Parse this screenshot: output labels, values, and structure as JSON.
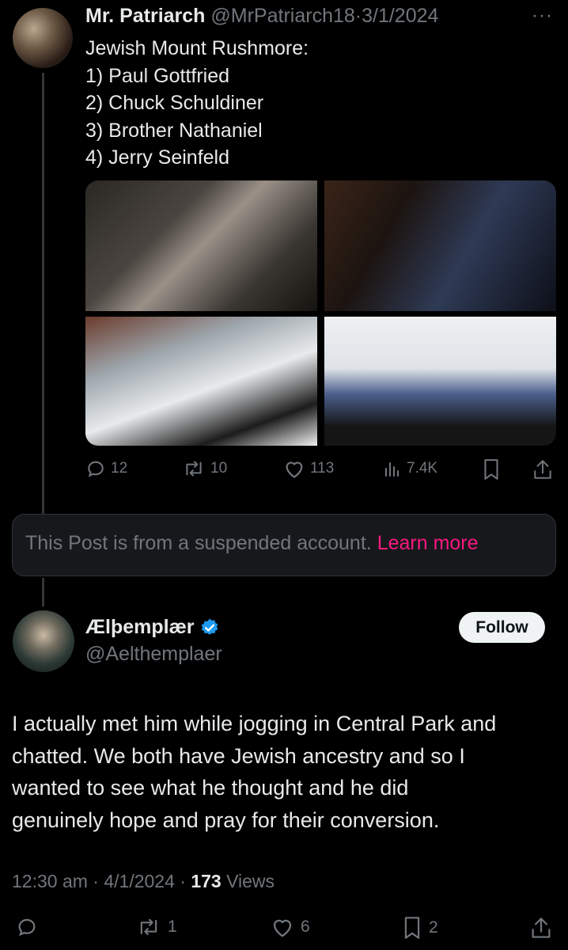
{
  "tweet1": {
    "name": "Mr. Patriarch",
    "handle": "@MrPatriarch18",
    "dot": "·",
    "date": "3/1/2024",
    "more": "···",
    "lines": [
      "Jewish Mount Rushmore:",
      "1) Paul Gottfried",
      "2) Chuck Schuldiner",
      "3) Brother Nathaniel",
      "4) Jerry Seinfeld"
    ],
    "actions": {
      "replies": "12",
      "reposts": "10",
      "likes": "113",
      "views": "7.4K"
    }
  },
  "suspended": {
    "text": "This Post is from a suspended account.",
    "link": "Learn more"
  },
  "tweet2": {
    "name": "Ælþemplær",
    "handle": "@Aelthemplaer",
    "follow_label": "Follow",
    "body_lines": [
      "I actually met him while jogging in Central Park and",
      "chatted. We both have Jewish ancestry and so I",
      "wanted to see what he thought and he did",
      "genuinely hope and pray for their conversion."
    ],
    "time": "12:30 am",
    "dot": "·",
    "date": "4/1/2024",
    "views_count": "173",
    "views_label": "Views",
    "actions": {
      "reposts": "1",
      "likes": "6",
      "bookmarks": "2"
    }
  },
  "colors": {
    "background": "#000000",
    "text": "#e7e9ea",
    "muted": "#71767b",
    "link": "#f91880",
    "verified": "#1d9bf0"
  }
}
